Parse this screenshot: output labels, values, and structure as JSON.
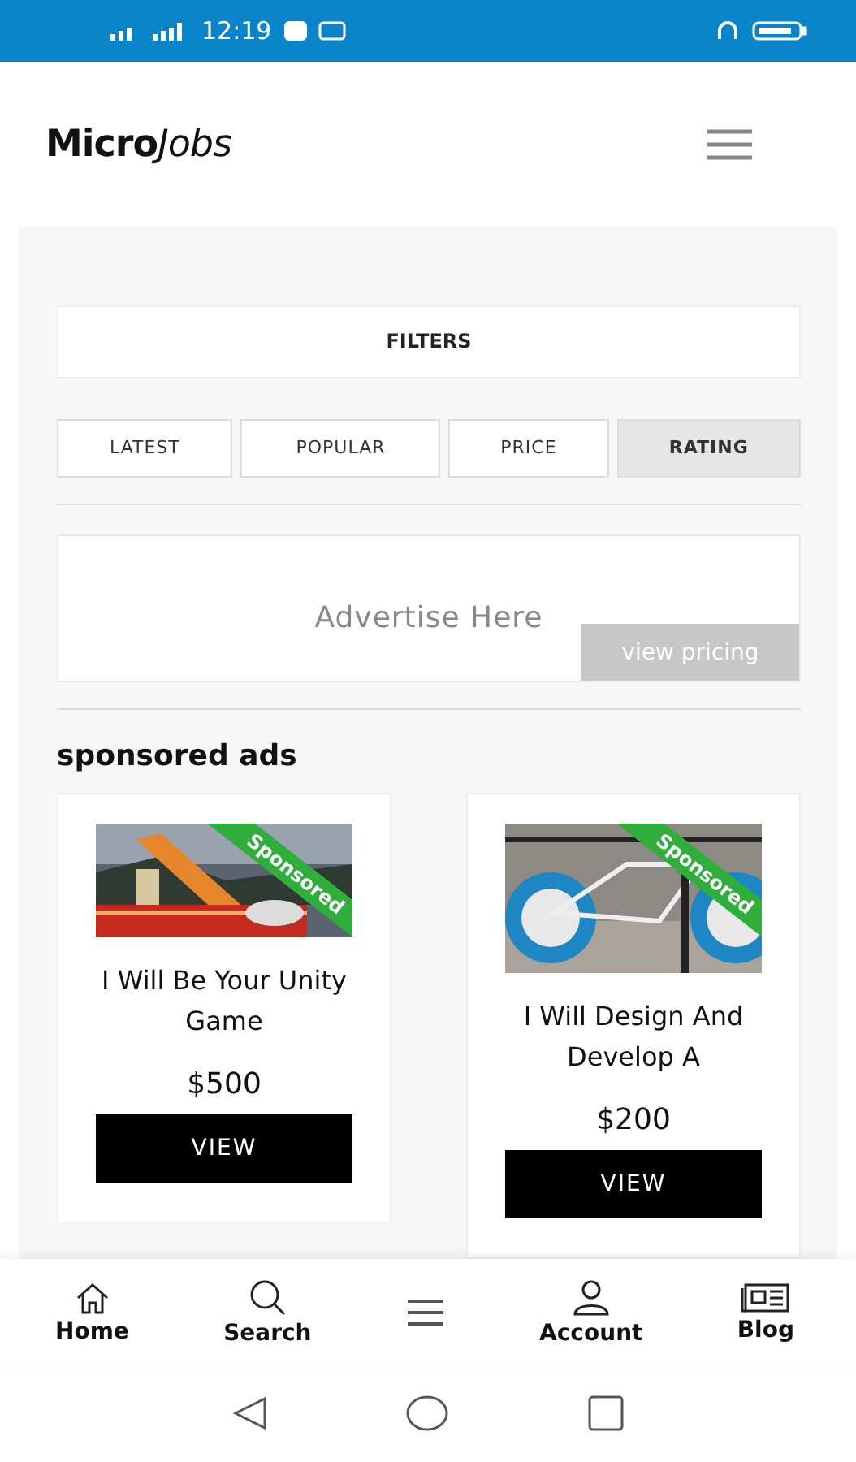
{
  "status_bar": {
    "time": "12:19"
  },
  "header": {
    "logo_bold": "Micro",
    "logo_italic": "Jobs"
  },
  "filters": {
    "label": "FILTERS"
  },
  "sort_tabs": [
    {
      "label": "LATEST",
      "selected": false
    },
    {
      "label": "POPULAR",
      "selected": false
    },
    {
      "label": "PRICE",
      "selected": false
    },
    {
      "label": "RATING",
      "selected": true
    }
  ],
  "ad_banner": {
    "text": "Advertise Here",
    "button": "view pricing"
  },
  "section_title": "sponsored ads",
  "listings": [
    {
      "kind": "game",
      "badge": "Sponsored",
      "title": "I Will Be Your Unity Game",
      "price": "$500",
      "button": "VIEW"
    },
    {
      "kind": "bike",
      "badge": "Sponsored",
      "title": "I Will Design And Develop A",
      "price": "$200",
      "button": "VIEW"
    }
  ],
  "bottom_nav": [
    {
      "kind": "home",
      "label": "Home"
    },
    {
      "kind": "search",
      "label": "Search"
    },
    {
      "kind": "menu"
    },
    {
      "kind": "account",
      "label": "Account"
    },
    {
      "kind": "blog",
      "label": "Blog"
    }
  ]
}
